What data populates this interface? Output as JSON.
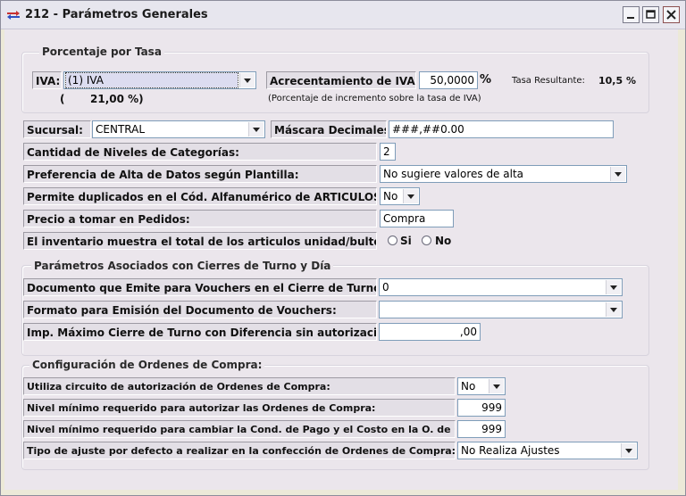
{
  "window": {
    "title": "212 - Parámetros Generales"
  },
  "porcentaje": {
    "group_title": "Porcentaje por Tasa",
    "iva_label": "IVA:",
    "iva_select": "(1) IVA",
    "iva_pct_open": "(",
    "iva_pct": "21,00 %)",
    "acrec_label": "Acrecentamiento de IVA:",
    "acrec_value": "50,0000",
    "acrec_unit": "%",
    "acrec_note": "(Porcentaje de incremento sobre la tasa de IVA)",
    "tasa_label": "Tasa Resultante:",
    "tasa_value": "10,5 %"
  },
  "general": {
    "sucursal_label": "Sucursal:",
    "sucursal_value": "CENTRAL",
    "mascara_label": "Máscara Decimales:",
    "mascara_value": "###,##0.00",
    "niveles_label": "Cantidad de Niveles de Categorías:",
    "niveles_value": "2",
    "preferencia_label": "Preferencia de Alta de Datos según Plantilla:",
    "preferencia_value": "No sugiere valores de alta",
    "duplicados_label": "Permite duplicados en el Cód. Alfanumérico de ARTICULOS:",
    "duplicados_value": "No",
    "precio_label": "Precio a tomar en Pedidos:",
    "precio_value": "Compra",
    "inventario_label": "El inventario muestra el total de los articulos unidad/bulto?",
    "radio_si": "Si",
    "radio_no": "No"
  },
  "cierres": {
    "group_title": "Parámetros Asociados con Cierres de Turno y Día",
    "documento_label": "Documento que Emite para Vouchers en el Cierre de Turno:",
    "documento_value": "0",
    "formato_label": "Formato para Emisión del Documento de Vouchers:",
    "formato_value": "",
    "importe_label": "Imp. Máximo Cierre de Turno con Diferencia sin autorización:",
    "importe_value": ",00"
  },
  "ordenes": {
    "group_title": "Configuración de Ordenes de Compra:",
    "circuito_label": "Utiliza circuito de autorización de Ordenes de Compra:",
    "circuito_value": "No",
    "nivel_autorizar_label": "Nivel mínimo requerido para autorizar las Ordenes de Compra:",
    "nivel_autorizar_value": "999",
    "nivel_cambiar_label": "Nivel mínimo requerido para cambiar la Cond. de Pago y el Costo en la O. de Compra:",
    "nivel_cambiar_value": "999",
    "ajuste_label": "Tipo de ajuste por defecto a realizar en la confección de Ordenes de Compra:",
    "ajuste_value": "No Realiza Ajustes"
  }
}
